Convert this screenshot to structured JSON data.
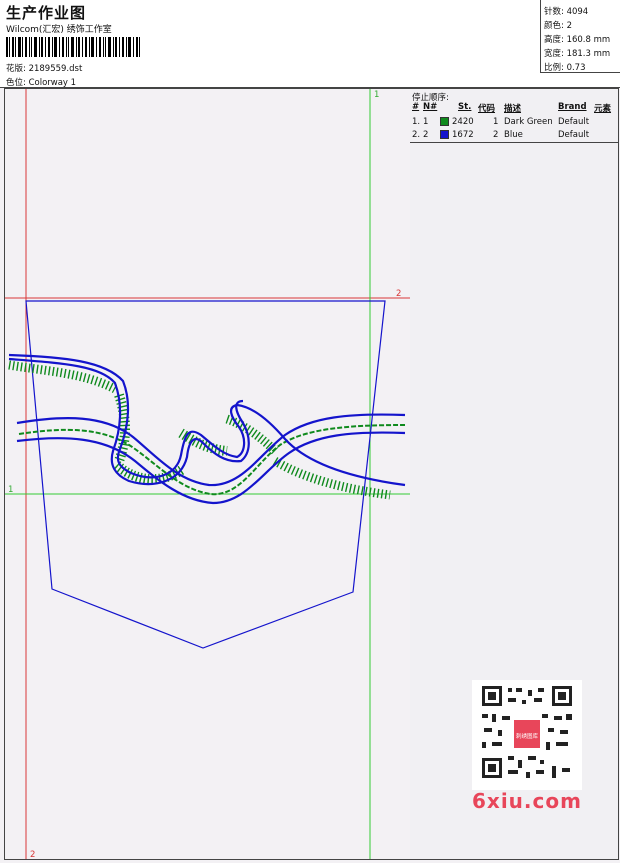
{
  "header": {
    "title": "生产作业图",
    "subtitle": "Wilcom(汇宏) 绣饰工作室",
    "design_label": "花版: 2189559.dst",
    "colorway_label": "色位: Colorway 1"
  },
  "stats": {
    "stitches": "针数: 4094",
    "colors": "颜色: 2",
    "height": "高度: 160.8 mm",
    "width": "宽度: 181.3 mm",
    "scale": "比例: 0.73"
  },
  "stop_sequence": {
    "title": "停止顺序:",
    "headers": [
      "#",
      "N#",
      "St.",
      "代码",
      "描述",
      "Brand",
      "元素"
    ],
    "rows": [
      {
        "seq": "1.",
        "n": "1",
        "color": "#0f8a1d",
        "stitches": "2420",
        "code": "1",
        "description": "Dark Green",
        "brand": "Default"
      },
      {
        "seq": "2.",
        "n": "2",
        "color": "#1414cc",
        "stitches": "1672",
        "code": "2",
        "description": "Blue",
        "brand": "Default"
      }
    ]
  },
  "guides": {
    "top_right": "1",
    "red_h": "2",
    "green_h": "1",
    "bottom_left": "2"
  },
  "watermark": {
    "stamp": "刺绣图库",
    "site": "6xiu.com"
  },
  "colors": {
    "thread_green": "#0f8a1d",
    "thread_blue": "#1414cc",
    "guide_red": "#d83838",
    "guide_green": "#33cc33"
  }
}
